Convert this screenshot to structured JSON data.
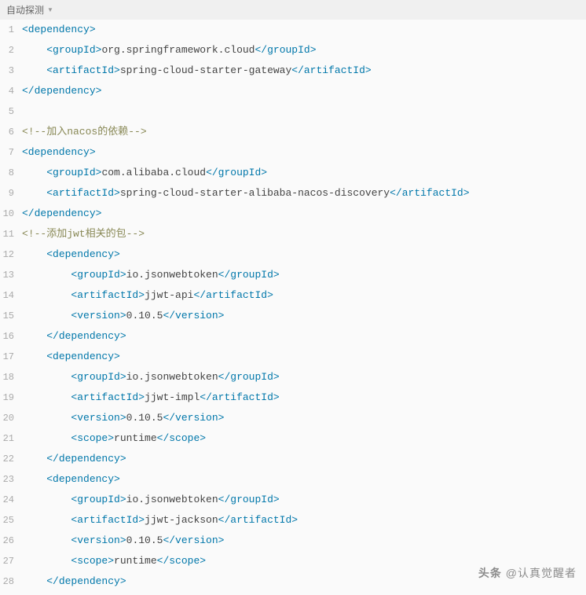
{
  "header": {
    "label": "自动探测"
  },
  "colors": {
    "tag": "#0077aa",
    "text": "#444444",
    "comment": "#888855",
    "lineNumber": "#aaaaaa"
  },
  "lines": [
    {
      "num": 1,
      "indent": 0,
      "tokens": [
        {
          "t": "tag",
          "v": "<dependency>"
        }
      ]
    },
    {
      "num": 2,
      "indent": 1,
      "tokens": [
        {
          "t": "tag",
          "v": "<groupId>"
        },
        {
          "t": "text",
          "v": "org.springframework.cloud"
        },
        {
          "t": "tag",
          "v": "</groupId>"
        }
      ]
    },
    {
      "num": 3,
      "indent": 1,
      "tokens": [
        {
          "t": "tag",
          "v": "<artifactId>"
        },
        {
          "t": "text",
          "v": "spring-cloud-starter-gateway"
        },
        {
          "t": "tag",
          "v": "</artifactId>"
        }
      ]
    },
    {
      "num": 4,
      "indent": 0,
      "tokens": [
        {
          "t": "tag",
          "v": "</dependency>"
        }
      ]
    },
    {
      "num": 5,
      "indent": 0,
      "tokens": []
    },
    {
      "num": 6,
      "indent": 0,
      "tokens": [
        {
          "t": "comment",
          "v": "<!--加入nacos的依赖-->"
        }
      ]
    },
    {
      "num": 7,
      "indent": 0,
      "tokens": [
        {
          "t": "tag",
          "v": "<dependency>"
        }
      ]
    },
    {
      "num": 8,
      "indent": 1,
      "tokens": [
        {
          "t": "tag",
          "v": "<groupId>"
        },
        {
          "t": "text",
          "v": "com.alibaba.cloud"
        },
        {
          "t": "tag",
          "v": "</groupId>"
        }
      ]
    },
    {
      "num": 9,
      "indent": 1,
      "tokens": [
        {
          "t": "tag",
          "v": "<artifactId>"
        },
        {
          "t": "text",
          "v": "spring-cloud-starter-alibaba-nacos-discovery"
        },
        {
          "t": "tag",
          "v": "</artifactId>"
        }
      ]
    },
    {
      "num": 10,
      "indent": 0,
      "tokens": [
        {
          "t": "tag",
          "v": "</dependency>"
        }
      ]
    },
    {
      "num": 11,
      "indent": 0,
      "tokens": [
        {
          "t": "comment",
          "v": "<!--添加jwt相关的包-->"
        }
      ]
    },
    {
      "num": 12,
      "indent": 1,
      "tokens": [
        {
          "t": "tag",
          "v": "<dependency>"
        }
      ]
    },
    {
      "num": 13,
      "indent": 2,
      "tokens": [
        {
          "t": "tag",
          "v": "<groupId>"
        },
        {
          "t": "text",
          "v": "io.jsonwebtoken"
        },
        {
          "t": "tag",
          "v": "</groupId>"
        }
      ]
    },
    {
      "num": 14,
      "indent": 2,
      "tokens": [
        {
          "t": "tag",
          "v": "<artifactId>"
        },
        {
          "t": "text",
          "v": "jjwt-api"
        },
        {
          "t": "tag",
          "v": "</artifactId>"
        }
      ]
    },
    {
      "num": 15,
      "indent": 2,
      "tokens": [
        {
          "t": "tag",
          "v": "<version>"
        },
        {
          "t": "text",
          "v": "0.10.5"
        },
        {
          "t": "tag",
          "v": "</version>"
        }
      ]
    },
    {
      "num": 16,
      "indent": 1,
      "tokens": [
        {
          "t": "tag",
          "v": "</dependency>"
        }
      ]
    },
    {
      "num": 17,
      "indent": 1,
      "tokens": [
        {
          "t": "tag",
          "v": "<dependency>"
        }
      ]
    },
    {
      "num": 18,
      "indent": 2,
      "tokens": [
        {
          "t": "tag",
          "v": "<groupId>"
        },
        {
          "t": "text",
          "v": "io.jsonwebtoken"
        },
        {
          "t": "tag",
          "v": "</groupId>"
        }
      ]
    },
    {
      "num": 19,
      "indent": 2,
      "tokens": [
        {
          "t": "tag",
          "v": "<artifactId>"
        },
        {
          "t": "text",
          "v": "jjwt-impl"
        },
        {
          "t": "tag",
          "v": "</artifactId>"
        }
      ]
    },
    {
      "num": 20,
      "indent": 2,
      "tokens": [
        {
          "t": "tag",
          "v": "<version>"
        },
        {
          "t": "text",
          "v": "0.10.5"
        },
        {
          "t": "tag",
          "v": "</version>"
        }
      ]
    },
    {
      "num": 21,
      "indent": 2,
      "tokens": [
        {
          "t": "tag",
          "v": "<scope>"
        },
        {
          "t": "text",
          "v": "runtime"
        },
        {
          "t": "tag",
          "v": "</scope>"
        }
      ]
    },
    {
      "num": 22,
      "indent": 1,
      "tokens": [
        {
          "t": "tag",
          "v": "</dependency>"
        }
      ]
    },
    {
      "num": 23,
      "indent": 1,
      "tokens": [
        {
          "t": "tag",
          "v": "<dependency>"
        }
      ]
    },
    {
      "num": 24,
      "indent": 2,
      "tokens": [
        {
          "t": "tag",
          "v": "<groupId>"
        },
        {
          "t": "text",
          "v": "io.jsonwebtoken"
        },
        {
          "t": "tag",
          "v": "</groupId>"
        }
      ]
    },
    {
      "num": 25,
      "indent": 2,
      "tokens": [
        {
          "t": "tag",
          "v": "<artifactId>"
        },
        {
          "t": "text",
          "v": "jjwt-jackson"
        },
        {
          "t": "tag",
          "v": "</artifactId>"
        }
      ]
    },
    {
      "num": 26,
      "indent": 2,
      "tokens": [
        {
          "t": "tag",
          "v": "<version>"
        },
        {
          "t": "text",
          "v": "0.10.5"
        },
        {
          "t": "tag",
          "v": "</version>"
        }
      ]
    },
    {
      "num": 27,
      "indent": 2,
      "tokens": [
        {
          "t": "tag",
          "v": "<scope>"
        },
        {
          "t": "text",
          "v": "runtime"
        },
        {
          "t": "tag",
          "v": "</scope>"
        }
      ]
    },
    {
      "num": 28,
      "indent": 1,
      "tokens": [
        {
          "t": "tag",
          "v": "</dependency>"
        }
      ]
    }
  ],
  "watermark": {
    "prefix": "头条",
    "suffix": " @认真觉醒者"
  }
}
